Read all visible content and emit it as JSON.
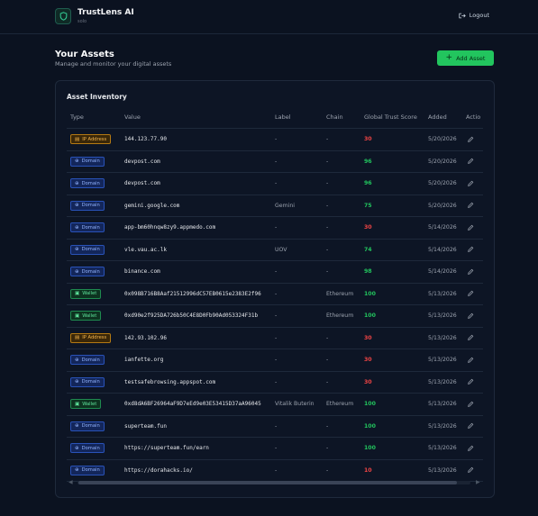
{
  "brand": {
    "name": "TrustLens AI",
    "subtitle": "solo"
  },
  "header": {
    "logout_label": "Logout"
  },
  "page": {
    "title": "Your Assets",
    "subtitle": "Manage and monitor your digital assets"
  },
  "actions": {
    "add_asset_label": "Add Asset",
    "add_icon": "+"
  },
  "inventory": {
    "title": "Asset Inventory",
    "columns": [
      "Type",
      "Value",
      "Label",
      "Chain",
      "Global Trust Score",
      "Added",
      "Actio"
    ],
    "rows": [
      {
        "type": "IP Address",
        "kind": "ip",
        "value": "144.123.77.90",
        "label": "-",
        "chain": "-",
        "score": "30",
        "score_level": "low",
        "added": "5/20/2026"
      },
      {
        "type": "Domain",
        "kind": "domain",
        "value": "devpost.com",
        "label": "-",
        "chain": "-",
        "score": "96",
        "score_level": "high",
        "added": "5/20/2026"
      },
      {
        "type": "Domain",
        "kind": "domain",
        "value": "devpost.com",
        "label": "-",
        "chain": "-",
        "score": "96",
        "score_level": "high",
        "added": "5/20/2026"
      },
      {
        "type": "Domain",
        "kind": "domain",
        "value": "gemini.google.com",
        "label": "Gemini",
        "chain": "-",
        "score": "75",
        "score_level": "high",
        "added": "5/20/2026"
      },
      {
        "type": "Domain",
        "kind": "domain",
        "value": "app-bm60hnqw8zy9.appmedo.com",
        "label": "-",
        "chain": "-",
        "score": "30",
        "score_level": "low",
        "added": "5/14/2026"
      },
      {
        "type": "Domain",
        "kind": "domain",
        "value": "vle.vau.ac.lk",
        "label": "UOV",
        "chain": "-",
        "score": "74",
        "score_level": "high",
        "added": "5/14/2026"
      },
      {
        "type": "Domain",
        "kind": "domain",
        "value": "binance.com",
        "label": "-",
        "chain": "-",
        "score": "98",
        "score_level": "high",
        "added": "5/14/2026"
      },
      {
        "type": "Wallet",
        "kind": "wallet",
        "value": "0x098B716B8Aaf21512996dC57EB0615e2383E2f96",
        "label": "-",
        "chain": "Ethereum",
        "score": "100",
        "score_level": "high",
        "added": "5/13/2026"
      },
      {
        "type": "Wallet",
        "kind": "wallet",
        "value": "0xd90e2f925DA726b50C4E8D0Fb90Ad053324F31b",
        "label": "-",
        "chain": "Ethereum",
        "score": "100",
        "score_level": "high",
        "added": "5/13/2026"
      },
      {
        "type": "IP Address",
        "kind": "ip",
        "value": "142.93.102.96",
        "label": "-",
        "chain": "-",
        "score": "30",
        "score_level": "low",
        "added": "5/13/2026"
      },
      {
        "type": "Domain",
        "kind": "domain",
        "value": "ianfette.org",
        "label": "-",
        "chain": "-",
        "score": "30",
        "score_level": "low",
        "added": "5/13/2026"
      },
      {
        "type": "Domain",
        "kind": "domain",
        "value": "testsafebrowsing.appspot.com",
        "label": "-",
        "chain": "-",
        "score": "30",
        "score_level": "low",
        "added": "5/13/2026"
      },
      {
        "type": "Wallet",
        "kind": "wallet",
        "value": "0xd8dA6BF26964aF9D7eEd9e03E53415D37aA96045",
        "label": "Vitalik Buterin",
        "chain": "Ethereum",
        "score": "100",
        "score_level": "high",
        "added": "5/13/2026"
      },
      {
        "type": "Domain",
        "kind": "domain",
        "value": "superteam.fun",
        "label": "-",
        "chain": "-",
        "score": "100",
        "score_level": "high",
        "added": "5/13/2026"
      },
      {
        "type": "Domain",
        "kind": "domain",
        "value": "https://superteam.fun/earn",
        "label": "-",
        "chain": "-",
        "score": "100",
        "score_level": "high",
        "added": "5/13/2026"
      },
      {
        "type": "Domain",
        "kind": "domain",
        "value": "https://dorahacks.io/",
        "label": "-",
        "chain": "-",
        "score": "10",
        "score_level": "low",
        "added": "5/13/2026"
      }
    ]
  },
  "colors": {
    "accent": "#22c55e",
    "score_high": "#22c55e",
    "score_low": "#ef4444",
    "background": "#0b1220"
  },
  "icons": {
    "brand": "shield-icon",
    "logout": "logout-icon",
    "edit": "pencil-icon",
    "domain": "globe-icon",
    "ip": "server-icon",
    "wallet": "wallet-icon"
  }
}
